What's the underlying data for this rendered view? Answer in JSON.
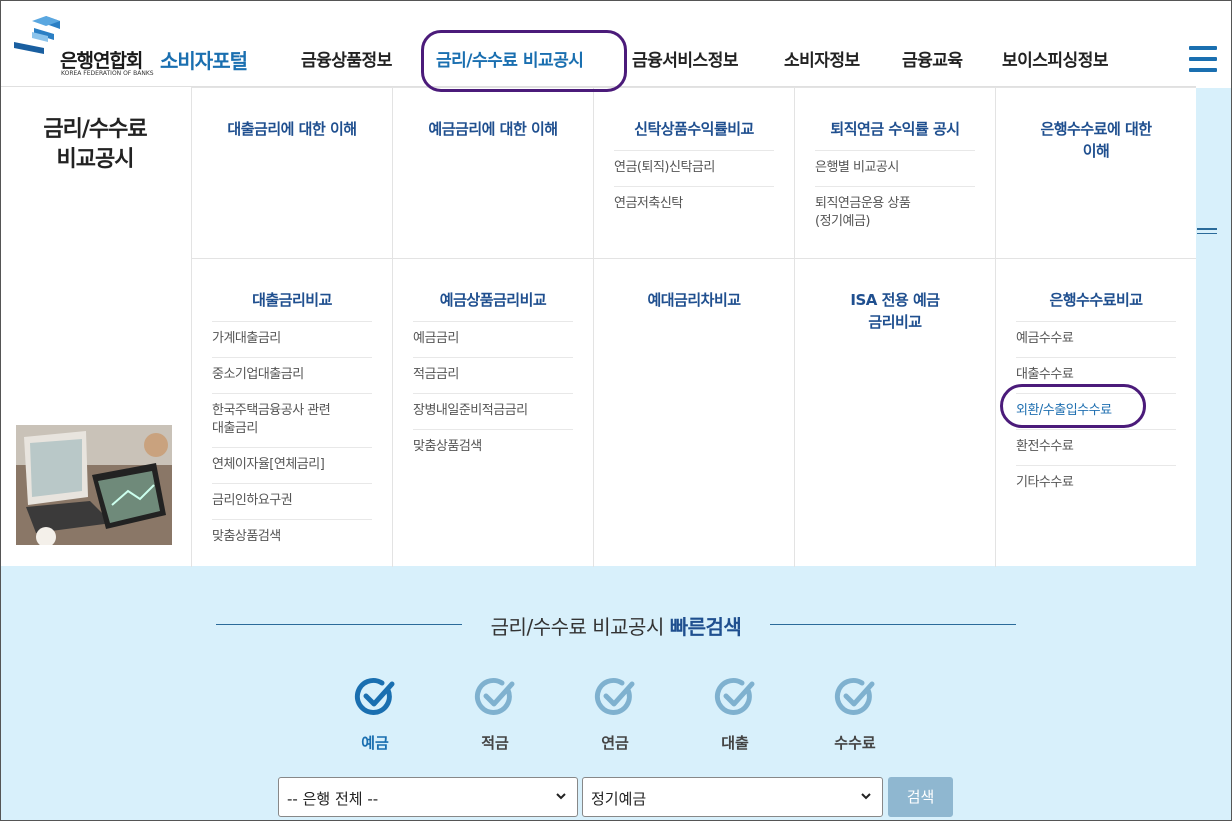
{
  "header": {
    "logo_main": "은행연합회",
    "logo_sub": "KOREA FEDERATION OF BANKS",
    "portal": "소비자포털",
    "nav": [
      "금융상품정보",
      "금리/수수료 비교공시",
      "금융서비스정보",
      "소비자정보",
      "금융교육",
      "보이스피싱정보"
    ],
    "active_nav": "금리/수수료 비교공시",
    "menu_icon": "hamburger-icon"
  },
  "mega_menu": {
    "title": "금리/수수료\n비교공시",
    "row1": [
      {
        "title": "대출금리에 대한 이해",
        "items": []
      },
      {
        "title": "예금금리에 대한 이해",
        "items": []
      },
      {
        "title": "신탁상품수익률비교",
        "items": [
          "연금(퇴직)신탁금리",
          "연금저축신탁"
        ]
      },
      {
        "title": "퇴직연금 수익률 공시",
        "items": [
          "은행별 비교공시",
          "퇴직연금운용 상품\n(정기예금)"
        ]
      },
      {
        "title": "은행수수료에 대한\n이해",
        "items": []
      }
    ],
    "row2": [
      {
        "title": "대출금리비교",
        "items": [
          "가계대출금리",
          "중소기업대출금리",
          "한국주택금융공사 관련\n대출금리",
          "연체이자율[연체금리]",
          "금리인하요구권",
          "맞춤상품검색"
        ]
      },
      {
        "title": "예금상품금리비교",
        "items": [
          "예금금리",
          "적금금리",
          "장병내일준비적금금리",
          "맞춤상품검색"
        ]
      },
      {
        "title": "예대금리차비교",
        "items": []
      },
      {
        "title": "ISA 전용 예금\n금리비교",
        "items": []
      },
      {
        "title": "은행수수료비교",
        "items": [
          "예금수수료",
          "대출수수료",
          "외환/수출입수수료",
          "환전수수료",
          "기타수수료"
        ]
      }
    ],
    "highlighted_item": "외환/수출입수수료"
  },
  "quick_search": {
    "title_prefix": "금리/수수료 비교공시",
    "title_bold": "빠른검색",
    "categories": [
      "예금",
      "적금",
      "연금",
      "대출",
      "수수료"
    ],
    "active_category": "예금",
    "bank_select": "-- 은행 전체 --",
    "product_select": "정기예금",
    "search_label": "검색"
  },
  "colors": {
    "accent": "#1a6fb0",
    "highlight_ring": "#4b1b7a",
    "background": "#d8f0fb",
    "search_button": "#8fb7d0"
  }
}
